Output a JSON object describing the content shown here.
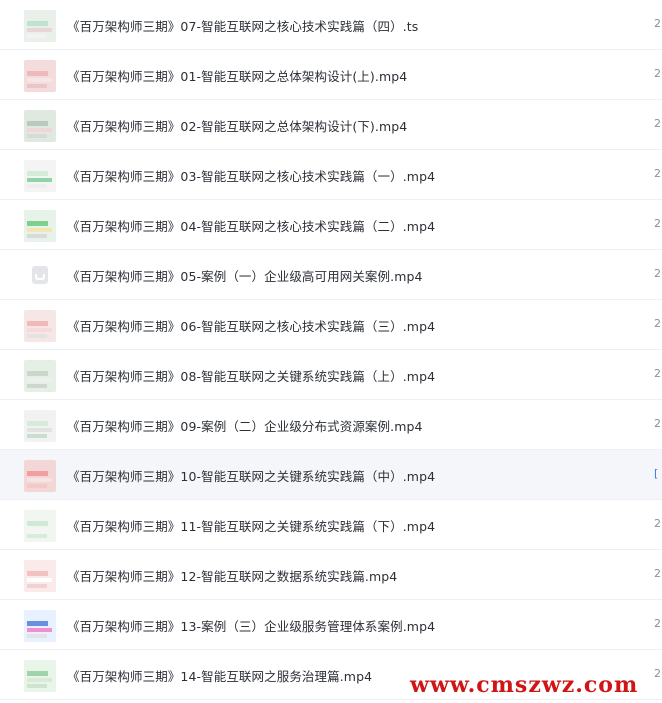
{
  "files": [
    {
      "name": "《百万架构师三期》07-智能互联网之核心技术实践篇（四）.ts",
      "size": "2",
      "thumb": [
        "#e9efe9",
        "#bfe3cf",
        "#e8d6d6",
        "#f2f2f2"
      ]
    },
    {
      "name": "《百万架构师三期》01-智能互联网之总体架构设计(上).mp4",
      "size": "2",
      "thumb": [
        "#f5dcdc",
        "#f0b9b9",
        "#f7e6e6",
        "#e9c6c6"
      ]
    },
    {
      "name": "《百万架构师三期》02-智能互联网之总体架构设计(下).mp4",
      "size": "2",
      "thumb": [
        "#dfe9df",
        "#b9c9bd",
        "#eed7d7",
        "#d9d9d9"
      ]
    },
    {
      "name": "《百万架构师三期》03-智能互联网之核心技术实践篇（一）.mp4",
      "size": "2",
      "thumb": [
        "#f4f4f4",
        "#d2ecd9",
        "#8fd3a8",
        "#eeeeee"
      ]
    },
    {
      "name": "《百万架构师三期》04-智能互联网之核心技术实践篇（二）.mp4",
      "size": "2",
      "thumb": [
        "#e7f3e8",
        "#7fcf8f",
        "#f4e5b7",
        "#dadada"
      ]
    },
    {
      "name": "《百万架构师三期》05-案例（一）企业级高可用网关案例.mp4",
      "size": "2",
      "thumb": []
    },
    {
      "name": "《百万架构师三期》06-智能互联网之核心技术实践篇（三）.mp4",
      "size": "2",
      "thumb": [
        "#f7e6e6",
        "#f1b9b9",
        "#f6d9d9",
        "#e3e3e3"
      ]
    },
    {
      "name": "《百万架构师三期》08-智能互联网之关键系统实践篇（上）.mp4",
      "size": "2",
      "thumb": [
        "#e6efe6",
        "#c9d8c9",
        "#eeeeee",
        "#cfd6cf"
      ]
    },
    {
      "name": "《百万架构师三期》09-案例（二）企业级分布式资源案例.mp4",
      "size": "2",
      "thumb": [
        "#f2f2f2",
        "#d6ebd9",
        "#e2e2e2",
        "#c9dfcd"
      ]
    },
    {
      "name": "《百万架构师三期》10-智能互联网之关键系统实践篇（中）.mp4",
      "size": "[",
      "thumb": [
        "#f3d6d6",
        "#ef9f9f",
        "#f8e3e3",
        "#f3c8c8"
      ],
      "active": true
    },
    {
      "name": "《百万架构师三期》11-智能互联网之关键系统实践篇（下）.mp4",
      "size": "2",
      "thumb": [
        "#f1f6f1",
        "#cfe9d5",
        "#f5f5f5",
        "#d7ecdb"
      ]
    },
    {
      "name": "《百万架构师三期》12-智能互联网之数据系统实践篇.mp4",
      "size": "2",
      "thumb": [
        "#fbeaea",
        "#f3c2c2",
        "#ffffff",
        "#f0d2d2"
      ]
    },
    {
      "name": "《百万架构师三期》13-案例（三）企业级服务管理体系案例.mp4",
      "size": "2",
      "thumb": [
        "#e8f1ff",
        "#6b8fdc",
        "#f28fd0",
        "#e3e3e3"
      ]
    },
    {
      "name": "《百万架构师三期》14-智能互联网之服务治理篇.mp4",
      "size": "2",
      "thumb": [
        "#eaf5ea",
        "#9fd3a9",
        "#d8ead8",
        "#cfe3cf"
      ]
    }
  ],
  "watermark": "www.cmszwz.com"
}
